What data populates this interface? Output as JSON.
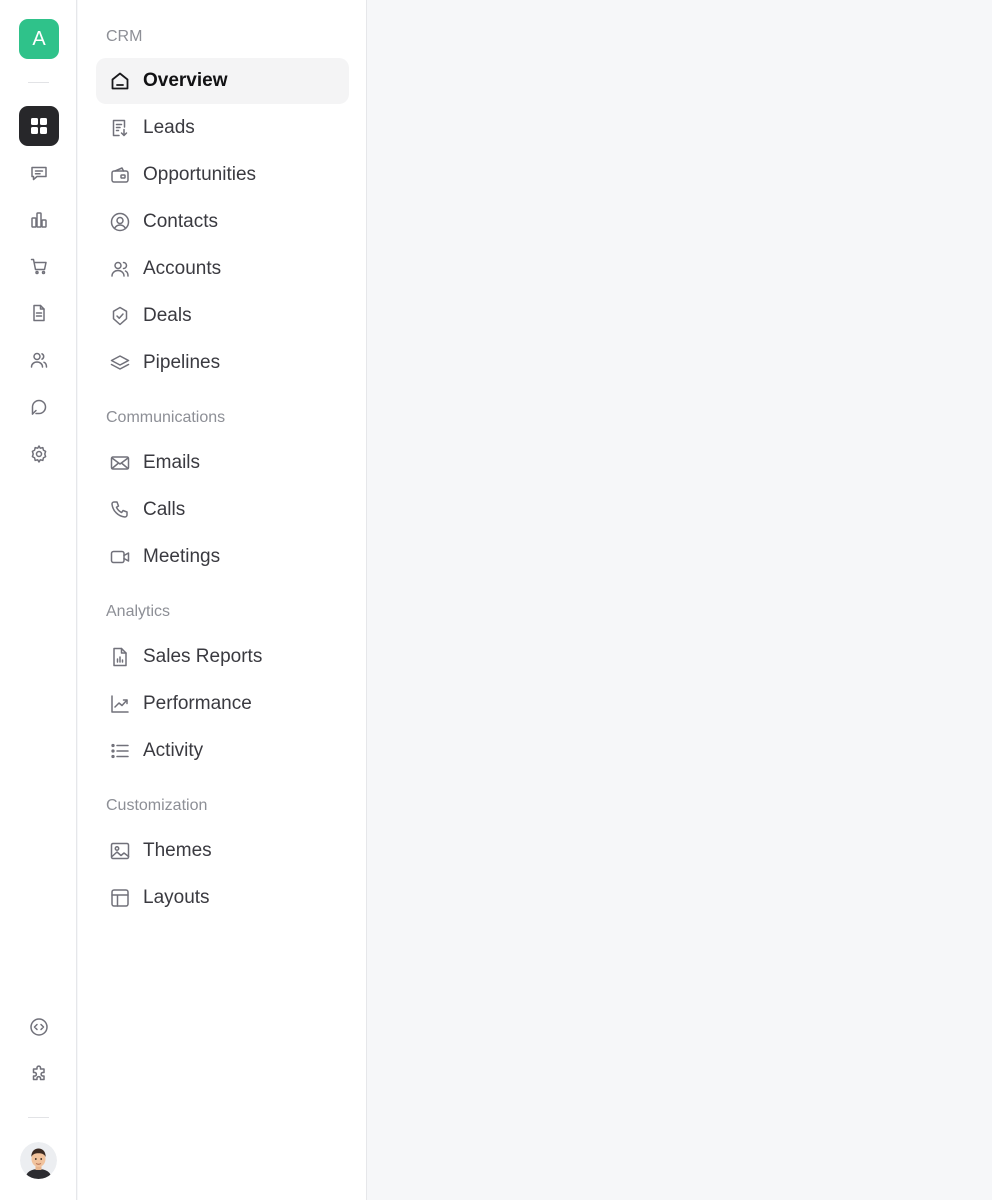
{
  "rail": {
    "logo_letter": "A",
    "accent_color": "#2fc28a",
    "top_icons": [
      "dashboard-icon",
      "message-icon",
      "chart-bars-icon",
      "cart-icon",
      "document-icon",
      "users-icon",
      "chat-bubble-icon",
      "gear-icon"
    ],
    "bottom_icons": [
      "code-icon",
      "puzzle-icon"
    ],
    "active_icon": "dashboard-icon"
  },
  "nav": {
    "groups": [
      {
        "label": "CRM",
        "items": [
          {
            "label": "Overview",
            "icon": "home-icon",
            "active": true
          },
          {
            "label": "Leads",
            "icon": "receipt-download-icon"
          },
          {
            "label": "Opportunities",
            "icon": "wallet-icon"
          },
          {
            "label": "Contacts",
            "icon": "user-circle-icon"
          },
          {
            "label": "Accounts",
            "icon": "users-icon"
          },
          {
            "label": "Deals",
            "icon": "badge-check-icon"
          },
          {
            "label": "Pipelines",
            "icon": "layers-icon"
          }
        ]
      },
      {
        "label": "Communications",
        "items": [
          {
            "label": "Emails",
            "icon": "mail-icon"
          },
          {
            "label": "Calls",
            "icon": "phone-icon"
          },
          {
            "label": "Meetings",
            "icon": "video-icon"
          }
        ]
      },
      {
        "label": "Analytics",
        "items": [
          {
            "label": "Sales Reports",
            "icon": "file-chart-icon"
          },
          {
            "label": "Performance",
            "icon": "trend-up-icon"
          },
          {
            "label": "Activity",
            "icon": "list-icon"
          }
        ]
      },
      {
        "label": "Customization",
        "items": [
          {
            "label": "Themes",
            "icon": "image-icon"
          },
          {
            "label": "Layouts",
            "icon": "layout-icon"
          }
        ]
      }
    ]
  }
}
